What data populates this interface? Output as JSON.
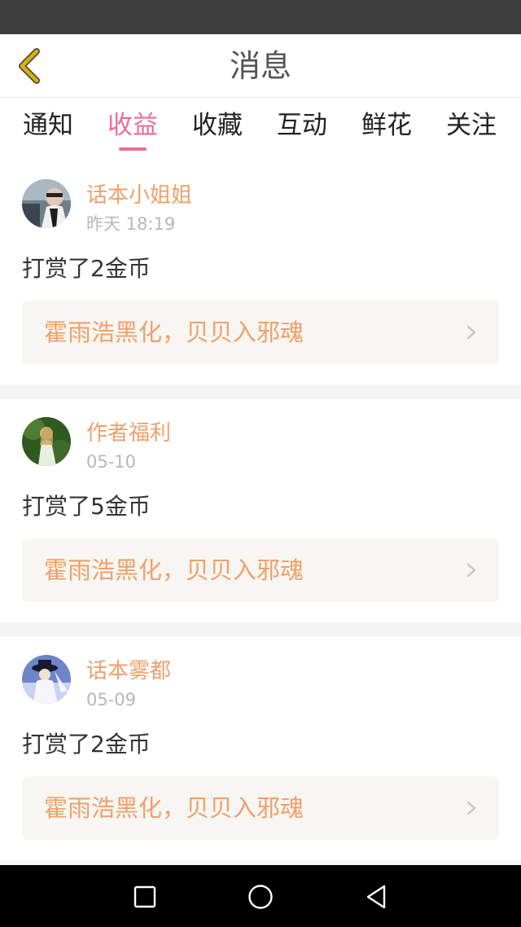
{
  "header": {
    "title": "消息",
    "back_icon": "chevron-left-icon",
    "back_color": "#d9b200"
  },
  "tabs": [
    {
      "label": "通知",
      "active": false
    },
    {
      "label": "收益",
      "active": true
    },
    {
      "label": "收藏",
      "active": false
    },
    {
      "label": "互动",
      "active": false
    },
    {
      "label": "鲜花",
      "active": false
    },
    {
      "label": "关注",
      "active": false
    }
  ],
  "accent_color": "#ec6d9a",
  "name_color": "#f0a06a",
  "messages": [
    {
      "name": "话本小姐姐",
      "time": "昨天 18:19",
      "text": "打赏了2金币",
      "book": "霍雨浩黑化，贝贝入邪魂"
    },
    {
      "name": "作者福利",
      "time": "05-10",
      "text": "打赏了5金币",
      "book": "霍雨浩黑化，贝贝入邪魂"
    },
    {
      "name": "话本雾都",
      "time": "05-09",
      "text": "打赏了2金币",
      "book": "霍雨浩黑化，贝贝入邪魂"
    }
  ],
  "nav": {
    "recents_icon": "square-icon",
    "home_icon": "circle-icon",
    "back_icon": "triangle-back-icon"
  }
}
